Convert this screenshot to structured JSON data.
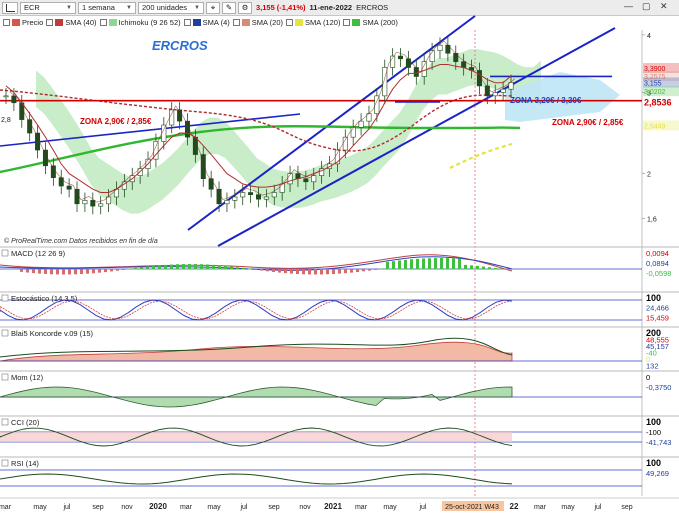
{
  "toolbar": {
    "symbol": "ECR",
    "timeframe": "1 semana",
    "units": "200 unidades",
    "price": "3,155",
    "change": "(-1,41%)",
    "date": "11-ene-2022",
    "name": "ERCROS"
  },
  "legend": [
    {
      "label": "Precio",
      "color": "#d9534f",
      "checked": false
    },
    {
      "label": "SMA (40)",
      "color": "#c23b3b",
      "checked": false
    },
    {
      "label": "Ichimoku (9 26 52)",
      "color": "#8fd68f",
      "checked": false
    },
    {
      "label": "SMA (4)",
      "color": "#1f3f9f",
      "checked": false
    },
    {
      "label": "SMA (20)",
      "color": "#d68a7a",
      "checked": false
    },
    {
      "label": "SMA (120)",
      "color": "#e4e43a",
      "checked": false
    },
    {
      "label": "SMA (200)",
      "color": "#3fbf3f",
      "checked": false
    }
  ],
  "chart_data": {
    "type": "line",
    "title": "ERCROS",
    "source": "© ProRealTime.com  Datos recibidos en fin de día",
    "x_ticks": [
      "mar",
      "may",
      "jul",
      "sep",
      "nov",
      "2020",
      "mar",
      "may",
      "jul",
      "sep",
      "nov",
      "2021",
      "mar",
      "may",
      "jul",
      "25-oct-2021 W43",
      "22",
      "mar",
      "may",
      "jul",
      "sep"
    ],
    "y_ticks": [
      "4",
      "3",
      "2",
      "1,6"
    ],
    "ylim": [
      1.4,
      4.1
    ],
    "log_scale": true,
    "price_labels": [
      {
        "text": "3,3900",
        "value": 3.39,
        "color": "#d10000"
      },
      {
        "text": "3,2575",
        "value": 3.2575,
        "color": "#d68a7a"
      },
      {
        "text": "3,155",
        "value": 3.155,
        "color": "#1f3f9f"
      },
      {
        "text": "3,0202",
        "value": 3.02,
        "color": "#3fbf3f"
      },
      {
        "text": "2,8536",
        "value": 2.8536,
        "color": "#d10000"
      },
      {
        "text": "2,5449",
        "value": 2.545,
        "color": "#e4e43a"
      }
    ],
    "left_label": "2,8",
    "zones": [
      {
        "text": "ZONA 3,20€ / 3,30€",
        "value": 3.25,
        "color": "#1f3fbf"
      },
      {
        "text": "ZONA 2,90€ / 2,85€",
        "value": 2.88,
        "color": "#d10000"
      },
      {
        "text": "ZONA 2,90€ / 2,85€",
        "value": 2.88,
        "color": "#d10000"
      }
    ],
    "price_series": [
      2.95,
      2.85,
      2.62,
      2.45,
      2.25,
      2.08,
      1.96,
      1.88,
      1.85,
      1.72,
      1.75,
      1.7,
      1.72,
      1.78,
      1.85,
      1.92,
      1.98,
      2.05,
      2.15,
      2.35,
      2.55,
      2.75,
      2.6,
      2.4,
      2.2,
      1.95,
      1.85,
      1.72,
      1.75,
      1.78,
      1.82,
      1.8,
      1.76,
      1.78,
      1.82,
      1.9,
      2.0,
      1.95,
      1.92,
      1.98,
      2.05,
      2.1,
      2.25,
      2.4,
      2.52,
      2.6,
      2.7,
      2.95,
      3.4,
      3.6,
      3.55,
      3.4,
      3.25,
      3.5,
      3.7,
      3.8,
      3.65,
      3.5,
      3.4,
      3.35,
      3.1,
      2.95,
      3.0,
      3.05,
      3.155
    ],
    "sma_series": [
      3.1,
      3.0,
      2.85,
      2.7,
      2.55,
      2.4,
      2.25,
      2.1,
      2.0,
      1.95,
      1.9,
      1.85,
      1.82,
      1.82,
      1.85,
      1.9,
      1.95,
      2.02,
      2.1,
      2.2,
      2.3,
      2.4,
      2.45,
      2.45,
      2.4,
      2.3,
      2.2,
      2.1,
      2.0,
      1.95,
      1.9,
      1.88,
      1.87,
      1.87,
      1.88,
      1.9,
      1.93,
      1.95,
      1.97,
      2.0,
      2.03,
      2.07,
      2.12,
      2.2,
      2.3,
      2.4,
      2.5,
      2.65,
      2.85,
      3.05,
      3.2,
      3.3,
      3.3,
      3.35,
      3.4,
      3.45,
      3.45,
      3.42,
      3.4,
      3.35,
      3.28,
      3.2,
      3.15,
      3.15,
      3.2575
    ]
  },
  "indicators": [
    {
      "name": "MACD (12 26 9)",
      "values": [
        "0,0094",
        "0,0894",
        "-0,0598"
      ],
      "colors": [
        "#d10000",
        "#1f3f9f",
        "#3fbf3f"
      ]
    },
    {
      "name": "Estocástico (14 3 5)",
      "values": [
        "100",
        "24,466",
        "15,459"
      ],
      "colors": [
        "#000",
        "#1f3f9f",
        "#d10000"
      ]
    },
    {
      "name": "Blai5 Koncorde v.09 (15)",
      "values": [
        "200",
        "48,555",
        "45,157",
        "-40",
        "0",
        "132"
      ],
      "colors": [
        "#000",
        "#d10000",
        "#1f3f9f",
        "#3fbf3f",
        "#e4e43a",
        "#1f3f9f"
      ]
    },
    {
      "name": "Mom (12)",
      "values": [
        "0",
        "-0,3750"
      ],
      "colors": [
        "#000",
        "#1f3f9f"
      ]
    },
    {
      "name": "CCI (20)",
      "values": [
        "100",
        "-100",
        "-41,743"
      ],
      "colors": [
        "#000",
        "#000",
        "#1f3f9f"
      ]
    },
    {
      "name": "RSI (14)",
      "values": [
        "100",
        "49,269"
      ],
      "colors": [
        "#000",
        "#1f3f9f"
      ]
    }
  ]
}
